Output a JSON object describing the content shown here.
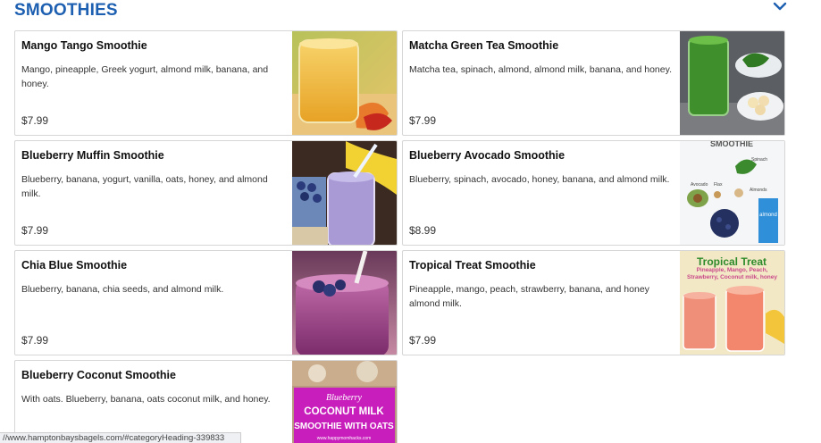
{
  "section": {
    "title": "SMOOTHIES",
    "toggle_icon": "chevron-down-icon",
    "accent_color": "#1d5fb0"
  },
  "items": [
    {
      "name": "Mango Tango Smoothie",
      "description": "Mango, pineapple, Greek yogurt, almond milk, banana, and honey.",
      "price": "$7.99"
    },
    {
      "name": "Matcha Green Tea Smoothie",
      "description": "Matcha tea, spinach, almond, almond milk, banana, and honey.",
      "price": "$7.99"
    },
    {
      "name": "Blueberry Muffin Smoothie",
      "description": "Blueberry, banana, yogurt, vanilla, oats, honey, and almond milk.",
      "price": "$7.99"
    },
    {
      "name": "Blueberry Avocado Smoothie",
      "description": "Blueberry, spinach, avocado, honey, banana, and almond milk.",
      "price": "$8.99"
    },
    {
      "name": "Chia Blue Smoothie",
      "description": "Blueberry, banana, chia seeds, and almond milk.",
      "price": "$7.99"
    },
    {
      "name": "Tropical Treat Smoothie",
      "description": "Pineapple, mango, peach, strawberry, banana, and honey almond milk.",
      "price": "$7.99"
    },
    {
      "name": "Blueberry Coconut Smoothie",
      "description": "With oats. Blueberry, banana, oats coconut milk, and honey.",
      "price": ""
    }
  ],
  "images": {
    "avocado_top": "SMOOTHIE",
    "avocado_labels": [
      "Avocado",
      "Flax",
      "Almonds",
      "Spinach"
    ],
    "avocado_carton": "almond",
    "tropical_title": "Tropical Treat",
    "tropical_sub": "Pineapple, Mango, Peach, Strawberry, Coconut milk, honey",
    "coconut_lines": [
      "Blueberry",
      "COCONUT MILK",
      "SMOOTHIE WITH OATS"
    ],
    "coconut_url": "www.happymomhacks.com"
  },
  "status_bar": {
    "url": "//www.hamptonbaysbagels.com/#categoryHeading-339833"
  }
}
